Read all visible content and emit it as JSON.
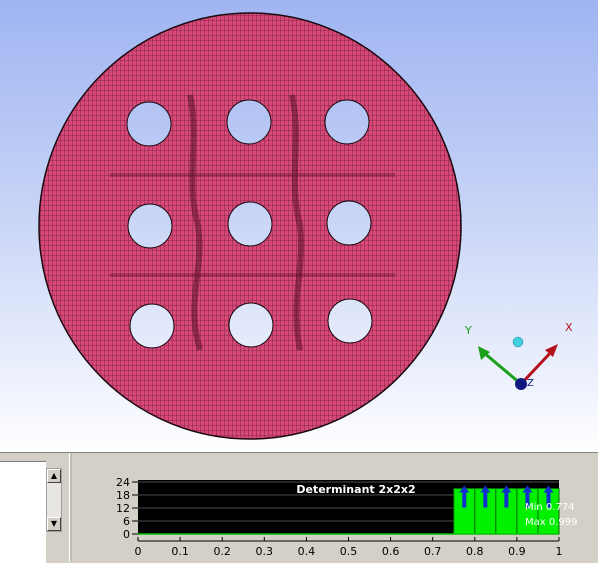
{
  "triad": {
    "x_label": "X",
    "y_label": "Y",
    "z_label": "Z"
  },
  "list_panel": {
    "scroll_up_icon": "▲",
    "scroll_down_icon": "▼"
  },
  "colors": {
    "mesh_fill": "#d8497a",
    "mesh_line": "#1a0810",
    "hole": "#ffffff",
    "x_axis": "#b4101e",
    "y_axis": "#1aa01a",
    "z_axis": "#101880",
    "histogram_bg": "#000000",
    "histogram_bar": "#00f000"
  },
  "chart_data": {
    "type": "bar",
    "title": "Determinant 2x2x2",
    "x_ticks": [
      "0",
      "0.1",
      "0.2",
      "0.3",
      "0.4",
      "0.5",
      "0.6",
      "0.7",
      "0.8",
      "0.9",
      "1"
    ],
    "y_ticks": [
      "0",
      "6",
      "12",
      "18",
      "24"
    ],
    "xlim": [
      0,
      1
    ],
    "ylim": [
      0,
      24
    ],
    "bins": [
      {
        "x0": 0.75,
        "x1": 0.8,
        "value": 21
      },
      {
        "x0": 0.8,
        "x1": 0.85,
        "value": 21
      },
      {
        "x0": 0.85,
        "x1": 0.9,
        "value": 21
      },
      {
        "x0": 0.9,
        "x1": 0.95,
        "value": 21
      },
      {
        "x0": 0.95,
        "x1": 1.0,
        "value": 21
      }
    ],
    "min_label": "Min 0.774",
    "max_label": "Max 0.999",
    "grid": true
  }
}
